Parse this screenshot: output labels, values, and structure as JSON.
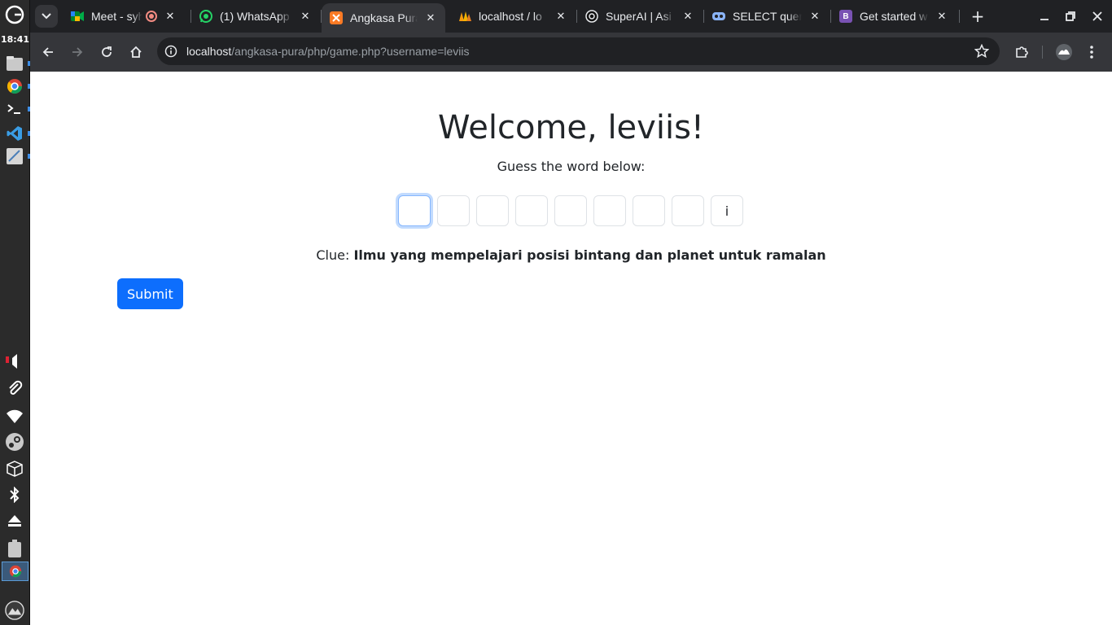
{
  "system": {
    "clock": "18:41"
  },
  "tabs": [
    {
      "title": "Meet - syh",
      "favicon": "google-meet-icon",
      "recording": true
    },
    {
      "title": "(1) WhatsApp",
      "favicon": "whatsapp-icon"
    },
    {
      "title": "Angkasa Pura",
      "favicon": "xampp-icon",
      "active": true
    },
    {
      "title": "localhost / lo",
      "favicon": "phpmyadmin-icon"
    },
    {
      "title": "SuperAI | Asi",
      "favicon": "superai-icon"
    },
    {
      "title": "SELECT query",
      "favicon": "db-icon"
    },
    {
      "title": "Get started w",
      "favicon": "bootstrap-icon",
      "favicon_letter": "B"
    }
  ],
  "address_bar": {
    "host": "localhost",
    "path": "/angkasa-pura/php/game.php?username=leviis"
  },
  "page": {
    "heading": "Welcome, leviis!",
    "subtitle": "Guess the word below:",
    "letters": [
      "",
      "",
      "",
      "",
      "",
      "",
      "",
      "",
      "i"
    ],
    "clue_label": "Clue:",
    "clue_text": "Ilmu yang mempelajari posisi bintang dan planet untuk ramalan",
    "submit_label": "Submit"
  },
  "colors": {
    "primary": "#0d6efd",
    "text": "#212529",
    "chrome_dark": "#202124",
    "chrome_toolbar": "#35363a"
  }
}
